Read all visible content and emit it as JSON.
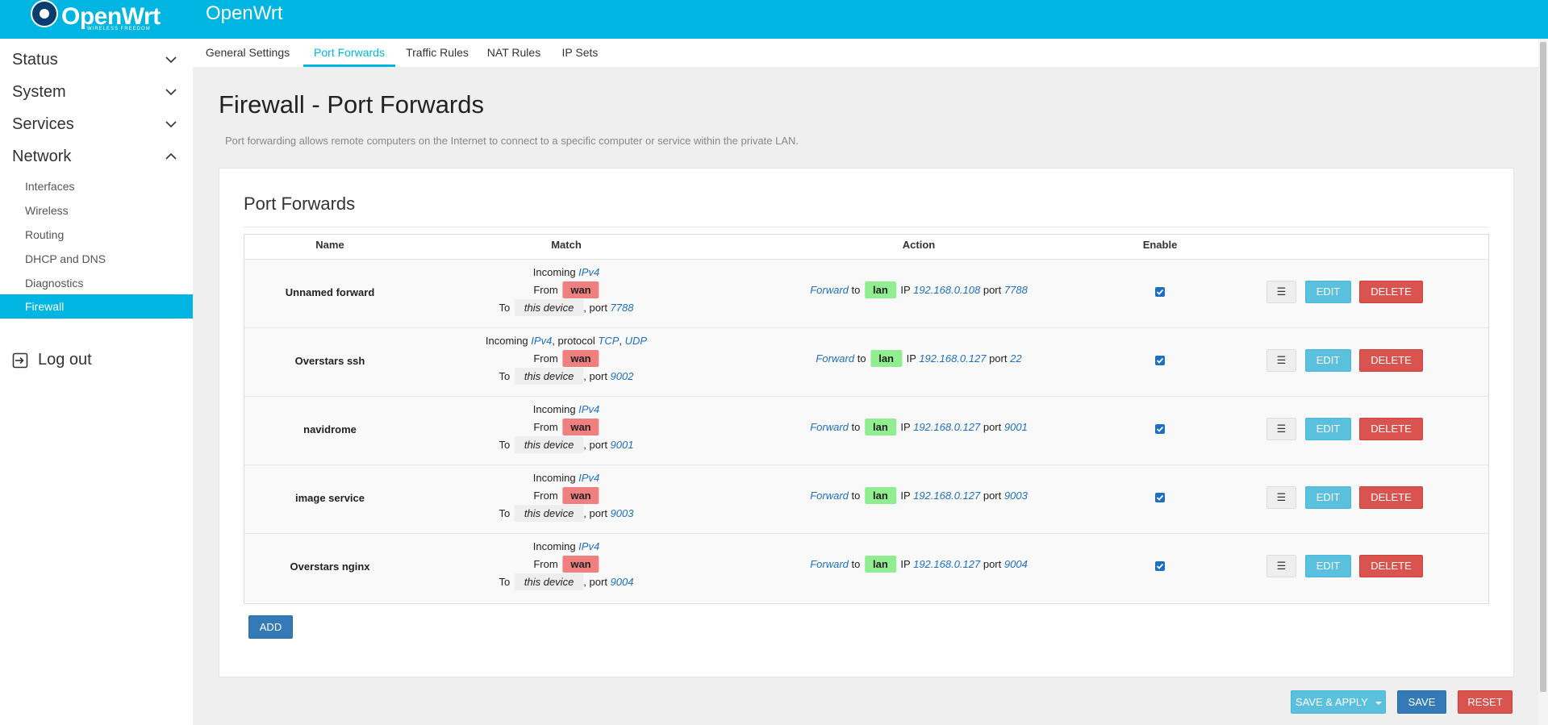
{
  "header": {
    "logo_text": "OpenWrt",
    "logo_subtext": "WIRELESS FREEDOM",
    "title": "OpenWrt"
  },
  "sidebar": {
    "top_items": [
      "Status",
      "System",
      "Services",
      "Network"
    ],
    "network_items": [
      "Interfaces",
      "Wireless",
      "Routing",
      "DHCP and DNS",
      "Diagnostics",
      "Firewall"
    ],
    "active_item": "Firewall",
    "logout": "Log out"
  },
  "tabs": [
    "General Settings",
    "Port Forwards",
    "Traffic Rules",
    "NAT Rules",
    "IP Sets"
  ],
  "active_tab": "Port Forwards",
  "page": {
    "title": "Firewall - Port Forwards",
    "description": "Port forwarding allows remote computers on the Internet to connect to a specific computer or service within the private LAN."
  },
  "section": {
    "title": "Port Forwards",
    "columns": {
      "name": "Name",
      "match": "Match",
      "action": "Action",
      "enable": "Enable"
    }
  },
  "text": {
    "incoming": "Incoming",
    "protocol": "protocol",
    "from": "From",
    "to": "To",
    "port_sep": ", port",
    "forward": "Forward",
    "to_word": "to",
    "ip": "IP",
    "port": "port",
    "sort_glyph": "☰",
    "edit": "EDIT",
    "delete": "DELETE"
  },
  "rules": [
    {
      "name": "Unnamed forward",
      "family": "IPv4",
      "protocols": [],
      "src_zone": "wan",
      "dest": "this device",
      "src_port": "7788",
      "dest_zone": "lan",
      "dest_ip": "192.168.0.108",
      "dest_port": "7788",
      "enabled": true
    },
    {
      "name": "Overstars ssh",
      "family": "IPv4",
      "protocols": [
        "TCP",
        "UDP"
      ],
      "src_zone": "wan",
      "dest": "this device",
      "src_port": "9002",
      "dest_zone": "lan",
      "dest_ip": "192.168.0.127",
      "dest_port": "22",
      "enabled": true
    },
    {
      "name": "navidrome",
      "family": "IPv4",
      "protocols": [],
      "src_zone": "wan",
      "dest": "this device",
      "src_port": "9001",
      "dest_zone": "lan",
      "dest_ip": "192.168.0.127",
      "dest_port": "9001",
      "enabled": true
    },
    {
      "name": "image service",
      "family": "IPv4",
      "protocols": [],
      "src_zone": "wan",
      "dest": "this device",
      "src_port": "9003",
      "dest_zone": "lan",
      "dest_ip": "192.168.0.127",
      "dest_port": "9003",
      "enabled": true
    },
    {
      "name": "Overstars nginx",
      "family": "IPv4",
      "protocols": [],
      "src_zone": "wan",
      "dest": "this device",
      "src_port": "9004",
      "dest_zone": "lan",
      "dest_ip": "192.168.0.127",
      "dest_port": "9004",
      "enabled": true
    }
  ],
  "buttons": {
    "add": "ADD",
    "save_apply": "SAVE & APPLY",
    "save": "SAVE",
    "reset": "RESET"
  },
  "colors": {
    "accent": "#00b5e2",
    "wan_zone": "#f08080",
    "lan_zone": "#90ee90",
    "edit": "#5bc0de",
    "delete": "#d9534f",
    "primary": "#337ab7"
  }
}
